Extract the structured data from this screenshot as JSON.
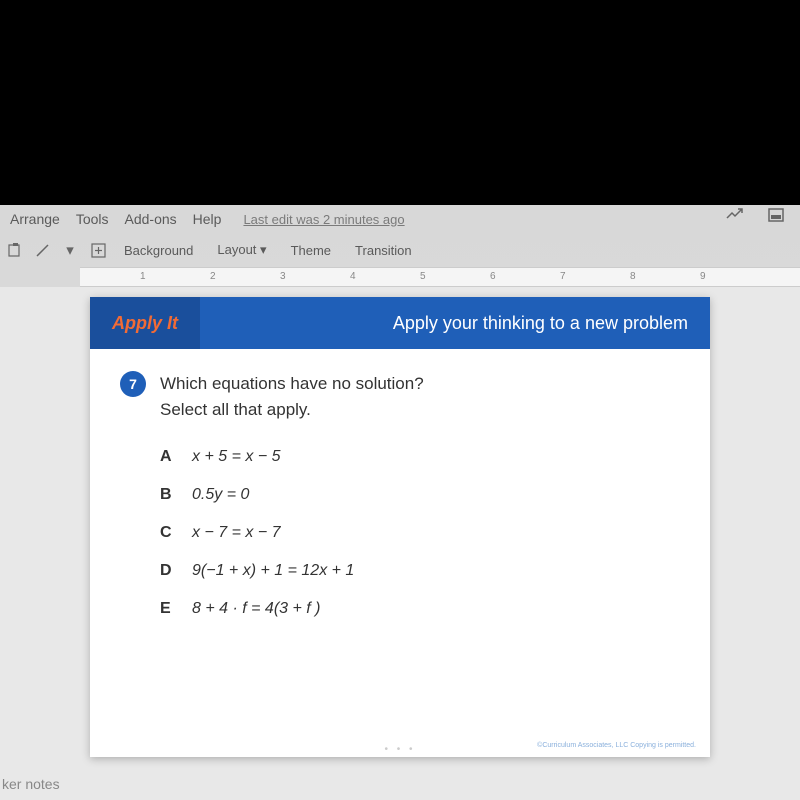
{
  "menu": {
    "arrange": "Arrange",
    "tools": "Tools",
    "addons": "Add-ons",
    "help": "Help",
    "last_edit": "Last edit was 2 minutes ago"
  },
  "toolbar": {
    "background": "Background",
    "layout": "Layout",
    "theme": "Theme",
    "transition": "Transition"
  },
  "ruler": {
    "t1": "1",
    "t2": "2",
    "t3": "3",
    "t4": "4",
    "t5": "5",
    "t6": "6",
    "t7": "7",
    "t8": "8",
    "t9": "9"
  },
  "slide": {
    "apply_it": "Apply It",
    "header_text": "Apply your thinking to a new problem",
    "q_number": "7",
    "q_text_line1": "Which equations have no solution?",
    "q_text_line2": "Select all that apply.",
    "choices": {
      "A": {
        "label": "A",
        "expr": "x + 5 = x − 5"
      },
      "B": {
        "label": "B",
        "expr": "0.5y = 0"
      },
      "C": {
        "label": "C",
        "expr": "x − 7 = x − 7"
      },
      "D": {
        "label": "D",
        "expr": "9(−1 + x) + 1 = 12x + 1"
      },
      "E": {
        "label": "E",
        "expr": "8 + 4 · f = 4(3 + f )"
      }
    },
    "footer": "©Curriculum Associates, LLC   Copying is permitted."
  },
  "speaker_notes": "ker notes"
}
